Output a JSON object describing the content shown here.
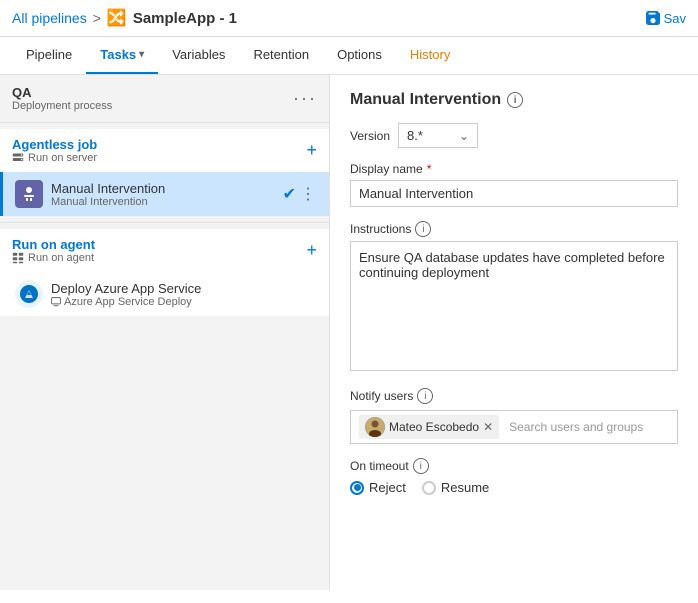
{
  "header": {
    "breadcrumb_link": "All pipelines",
    "sep": ">",
    "pipeline_name": "SampleApp - 1",
    "save_label": "Sav"
  },
  "nav": {
    "tabs": [
      {
        "id": "pipeline",
        "label": "Pipeline",
        "active": false
      },
      {
        "id": "tasks",
        "label": "Tasks",
        "active": true,
        "has_arrow": true
      },
      {
        "id": "variables",
        "label": "Variables",
        "active": false
      },
      {
        "id": "retention",
        "label": "Retention",
        "active": false
      },
      {
        "id": "options",
        "label": "Options",
        "active": false
      },
      {
        "id": "history",
        "label": "History",
        "active": false,
        "highlight": true
      }
    ]
  },
  "left_panel": {
    "stage": {
      "title": "QA",
      "subtitle": "Deployment process"
    },
    "agentless_job": {
      "title": "Agentless job",
      "subtitle": "Run on server"
    },
    "manual_intervention": {
      "name": "Manual Intervention",
      "detail": "Manual Intervention",
      "selected": true
    },
    "run_on_agent": {
      "title": "Run on agent",
      "subtitle": "Run on agent"
    },
    "deploy_task": {
      "name": "Deploy Azure App Service",
      "detail": "Azure App Service Deploy"
    }
  },
  "right_panel": {
    "title": "Manual Intervention",
    "version_label": "Version",
    "version_value": "8.*",
    "display_name_label": "Display name",
    "required_marker": "*",
    "display_name_value": "Manual Intervention",
    "instructions_label": "Instructions",
    "instructions_value": "Ensure QA database updates have completed before continuing deployment",
    "notify_users_label": "Notify users",
    "user_name": "Mateo Escobedo",
    "search_placeholder": "Search users and groups",
    "on_timeout_label": "On timeout",
    "timeout_options": [
      {
        "label": "Reject",
        "selected": true
      },
      {
        "label": "Resume",
        "selected": false
      }
    ]
  }
}
